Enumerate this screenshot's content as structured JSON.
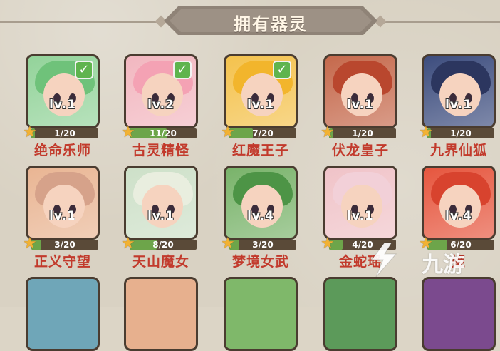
{
  "header": {
    "title": "拥有器灵"
  },
  "checkmark_glyph": "✓",
  "star_glyph": "★",
  "colors": {
    "name_red": "#c23a2c",
    "fragment_green": "#6da54a",
    "check_green": "#5fb44e"
  },
  "spirits": [
    {
      "name": "绝命乐师",
      "level": "lv.1",
      "fragments": "1/20",
      "fragment_fraction": 0.05,
      "owned_check": true,
      "portrait_bg": "#93d39a",
      "hair": "#6fc27a"
    },
    {
      "name": "古灵精怪",
      "level": "lv.2",
      "fragments": "11/20",
      "fragment_fraction": 0.55,
      "owned_check": true,
      "portrait_bg": "#f2b7c0",
      "hair": "#f4a2b4"
    },
    {
      "name": "红魔王子",
      "level": "lv.1",
      "fragments": "7/20",
      "fragment_fraction": 0.35,
      "owned_check": true,
      "portrait_bg": "#f4c24d",
      "hair": "#f2b52c"
    },
    {
      "name": "伏龙皇子",
      "level": "lv.1",
      "fragments": "1/20",
      "fragment_fraction": 0.05,
      "owned_check": false,
      "portrait_bg": "#c5694c",
      "hair": "#b9472e"
    },
    {
      "name": "九界仙狐",
      "level": "lv.1",
      "fragments": "1/20",
      "fragment_fraction": 0.05,
      "owned_check": false,
      "portrait_bg": "#3d4d7e",
      "hair": "#2c365f"
    },
    {
      "name": "正义守望",
      "level": "lv.1",
      "fragments": "3/20",
      "fragment_fraction": 0.15,
      "owned_check": false,
      "portrait_bg": "#e9b593",
      "hair": "#d6a28a"
    },
    {
      "name": "天山魔女",
      "level": "lv.1",
      "fragments": "8/20",
      "fragment_fraction": 0.4,
      "owned_check": false,
      "portrait_bg": "#cde0c8",
      "hair": "#e9eedf"
    },
    {
      "name": "梦境女武",
      "level": "lv.4",
      "fragments": "3/20",
      "fragment_fraction": 0.15,
      "owned_check": false,
      "portrait_bg": "#79b36a",
      "hair": "#4d9446"
    },
    {
      "name": "金蛇瑶",
      "level": "lv.1",
      "fragments": "4/20",
      "fragment_fraction": 0.2,
      "owned_check": false,
      "portrait_bg": "#f0c3c8",
      "hair": "#f2d0d8"
    },
    {
      "name": "姬",
      "level": "lv.4",
      "fragments": "6/20",
      "fragment_fraction": 0.3,
      "owned_check": false,
      "portrait_bg": "#e6563e",
      "hair": "#d8432e"
    }
  ],
  "partial_row": [
    {
      "portrait_bg": "#6fa6b8"
    },
    {
      "portrait_bg": "#e7b08e"
    },
    {
      "portrait_bg": "#7fb86a"
    },
    {
      "portrait_bg": "#5c9a5a"
    },
    {
      "portrait_bg": "#7b4a8e"
    }
  ],
  "watermark": {
    "text": "九游"
  }
}
